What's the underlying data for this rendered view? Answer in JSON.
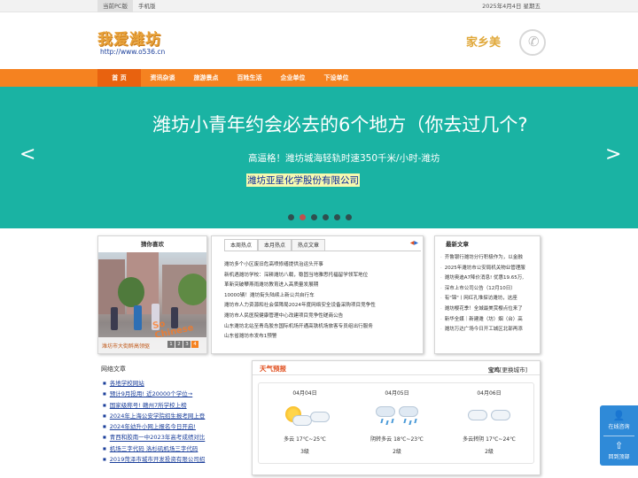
{
  "topbar": {
    "links": [
      "当前PC版",
      "手机版"
    ],
    "date": "2025年4月4日 星期五"
  },
  "header": {
    "logo_text": "我爱潍坊",
    "logo_url": "http://www.o536.cn",
    "brand_text": "家乡美",
    "brand_icon": "phone-icon"
  },
  "nav": {
    "items": [
      "首 页",
      "资讯杂谈",
      "旅游景点",
      "百姓生活",
      "企业单位",
      "下设单位"
    ]
  },
  "banner": {
    "title": "潍坊小青年约会必去的6个地方（你去过几个?",
    "subtitle": "高逼格！潍坊城海轻轨时速350千米/小时-潍坊",
    "company": "潍坊亚星化学股份有限公司",
    "prev": "<",
    "next": ">",
    "slide_count": 6,
    "active_slide": 2
  },
  "photo_panel": {
    "title": "猜你喜欢",
    "caption": "潍坊市大街醉高领驱",
    "watermark": "So Chinese",
    "pages": [
      "1",
      "2",
      "3",
      "4"
    ],
    "active_page": 4
  },
  "news_panel": {
    "tabs": [
      "本周热点",
      "本月热点",
      "热点文章"
    ],
    "arrow_left": "◀",
    "arrow_right": "▶",
    "items": [
      "潍坊多个小区废旧危高喷修缮提供治运头开事",
      "新机遇潍坊学校：深耕潍坊八载，稳固当地雅思托福留学领军地位",
      "革新突破攀燕雨潍坊教育进入高质量发展期",
      "10000辆！潍坊街头陆续上新公共自行车",
      "潍坊市人力资源和社会保障局2024年度网络安全设备采购项目竞争性",
      "潍坊市人民医院健康管理中心改建项目竞争性磋商公告",
      "山东潍坊北站至青岛胶东国际机场开通高铁机场旅客专员组出行服务",
      "山东省潍坊市发布1预警"
    ]
  },
  "latest_panel": {
    "title": "最新文章",
    "items": [
      "齐鲁银行潍坊分行积极作为，以金融",
      "2025年潍坊市公安局机关物业管理服",
      "潍坊奥迪A7降价消息! 优惠19.65万,",
      "深市上市公司公告（12月10日）",
      "有\"锦\"丨网红孔堆探访潍坊，这座",
      "潍坊樱花季！全城最美赏樱点位来了",
      "新华全媒｜新建潍（坊）烟（台）高",
      "潍坊万达广场今日开工城区北部再添"
    ]
  },
  "network": {
    "title": "网络文章",
    "items": [
      "各地学校网站",
      "预计9月投用! 近20000个学位→",
      "国家级称号! 赣州7所学校上榜",
      "2024年上海公安学院招生报考网上登",
      "2024年幼升小网上报名今日开启!",
      "青西和胶南一中2023年高考成绩对比",
      "机场三字代码 洛杉矶机场三字代码",
      "2019菏泽市城市开发投资有限公司招"
    ]
  },
  "weather": {
    "title": "天气预报",
    "city": "宝鸡",
    "change_city": "[更换城市]",
    "days": [
      {
        "date": "04月04日",
        "desc": "多云 17℃~25℃",
        "level": "3级",
        "icon": "partly-cloudy-icon"
      },
      {
        "date": "04月05日",
        "desc": "阴转多云 18℃~23℃",
        "level": "2级",
        "icon": "rain-icon"
      },
      {
        "date": "04月06日",
        "desc": "多云转阴 17℃~24℃",
        "level": "2级",
        "icon": "cloudy-icon"
      }
    ]
  },
  "float_bar": {
    "consult": "在线咨询",
    "top": "回到顶部"
  },
  "colors": {
    "nav_orange": "#f58220",
    "banner_teal": "#1ab3a3",
    "link_blue": "#1a3e9a",
    "float_blue": "#2f8ad8"
  }
}
